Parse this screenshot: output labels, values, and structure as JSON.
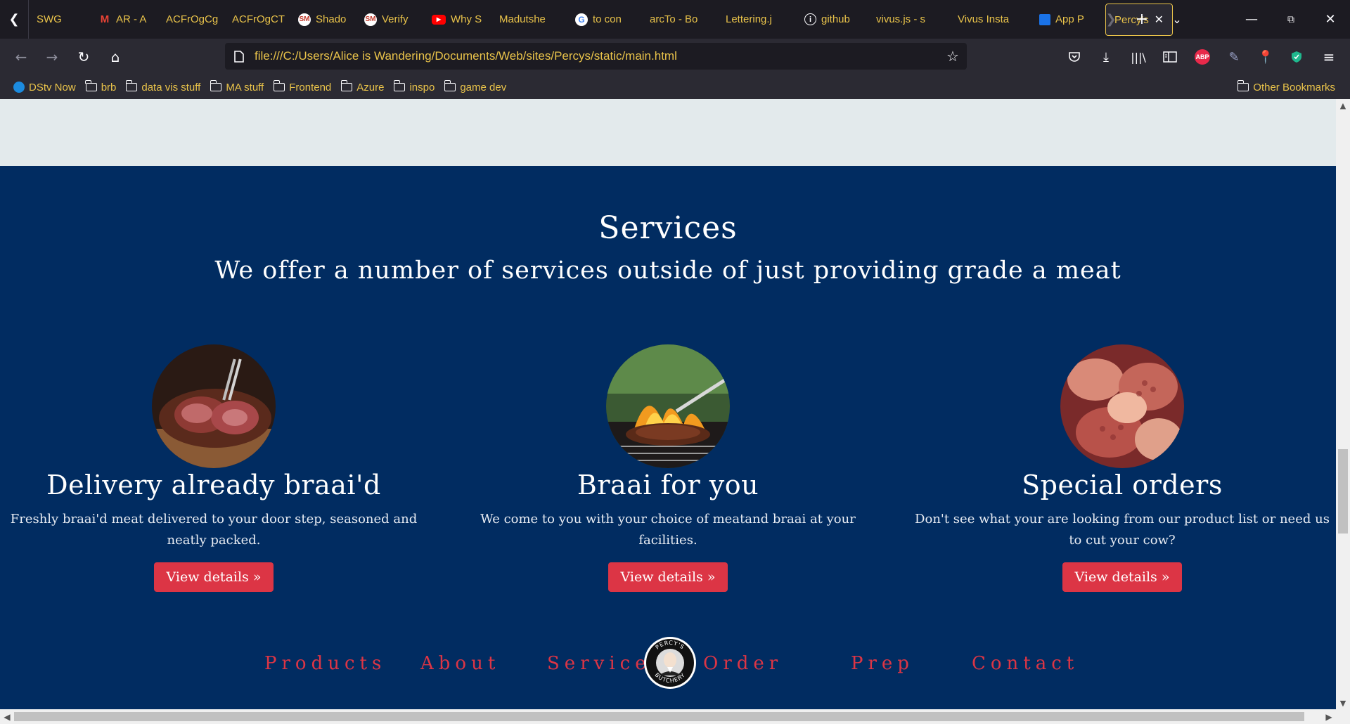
{
  "browser": {
    "tabs": [
      {
        "label": "SWG",
        "icon": "none"
      },
      {
        "label": "AR - A",
        "icon": "gmail-icon"
      },
      {
        "label": "ACFrOgCg",
        "icon": "none"
      },
      {
        "label": "ACFrOgCT",
        "icon": "none"
      },
      {
        "label": "Shado",
        "icon": "sm-icon"
      },
      {
        "label": "Verify",
        "icon": "sm-icon"
      },
      {
        "label": "Why S",
        "icon": "youtube-icon"
      },
      {
        "label": "Madutshe",
        "icon": "none"
      },
      {
        "label": "to con",
        "icon": "google-icon"
      },
      {
        "label": "arcTo - Bo",
        "icon": "none"
      },
      {
        "label": "Lettering.j",
        "icon": "none"
      },
      {
        "label": "github",
        "icon": "info-icon"
      },
      {
        "label": "vivus.js - s",
        "icon": "none"
      },
      {
        "label": "Vivus Insta",
        "icon": "none"
      },
      {
        "label": "App P",
        "icon": "app-icon"
      }
    ],
    "active_tab": "Percy's",
    "url": "file:///C:/Users/Alice is Wandering/Documents/Web/sites/Percys/static/main.html",
    "bookmarks": [
      {
        "label": "DStv Now",
        "icon": "dstv-icon"
      },
      {
        "label": "brb",
        "icon": "folder-icon"
      },
      {
        "label": "data vis stuff",
        "icon": "folder-icon"
      },
      {
        "label": "MA stuff",
        "icon": "folder-icon"
      },
      {
        "label": "Frontend",
        "icon": "folder-icon"
      },
      {
        "label": "Azure",
        "icon": "folder-icon"
      },
      {
        "label": "inspo",
        "icon": "folder-icon"
      },
      {
        "label": "game dev",
        "icon": "folder-icon"
      }
    ],
    "other_bookmarks": "Other Bookmarks",
    "abp_label": "ABP"
  },
  "page": {
    "services": {
      "title": "Services",
      "subtitle": "We offer a number of services outside of just providing grade a meat",
      "cards": [
        {
          "heading": "Delivery already braai'd",
          "text": "Freshly braai'd meat delivered to your door step, seasoned and neatly packed.",
          "button": "View details »"
        },
        {
          "heading": "Braai for you",
          "text": "We come to you with your choice of meatand braai at your facilities.",
          "button": "View details »"
        },
        {
          "heading": "Special orders",
          "text": "Don't see what your are looking from our product list or need us to cut your cow?",
          "button": "View details »"
        }
      ]
    },
    "footer_nav": [
      "Products",
      "About",
      "Services",
      "Order",
      "Prep",
      "Contact"
    ],
    "logo_text_top": "PERCY'S",
    "logo_text_bottom": "BUTCHERY"
  },
  "colors": {
    "navy": "#012c61",
    "accent_red": "#dc3545",
    "tab_text": "#e9c34a",
    "grey_band": "#e3eaec"
  }
}
